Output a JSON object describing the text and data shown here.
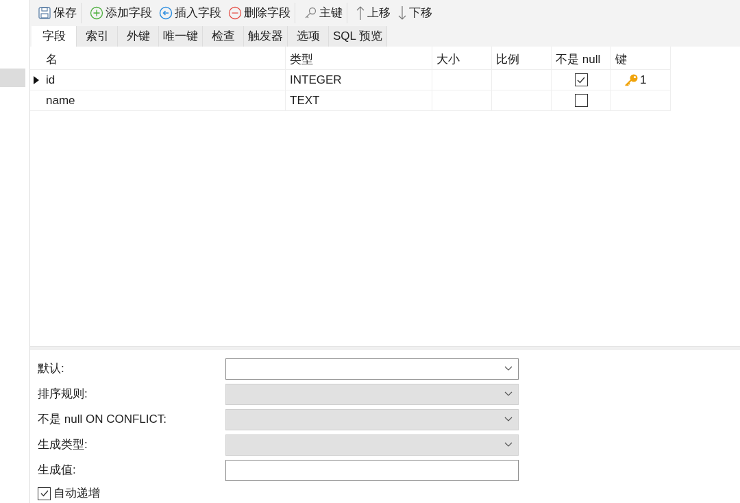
{
  "toolbar": [
    [
      {
        "kind": "save",
        "label": "保存"
      }
    ],
    [
      {
        "kind": "add",
        "label": "添加字段"
      },
      {
        "kind": "insert",
        "label": "插入字段"
      },
      {
        "kind": "delete",
        "label": "删除字段"
      }
    ],
    [
      {
        "kind": "key",
        "label": "主键"
      }
    ],
    [
      {
        "kind": "up",
        "label": "上移"
      },
      {
        "kind": "down",
        "label": "下移"
      }
    ]
  ],
  "tabs": [
    {
      "label": "字段",
      "selected": true
    },
    {
      "label": "索引",
      "selected": false
    },
    {
      "label": "外键",
      "selected": false
    },
    {
      "label": "唯一键",
      "selected": false
    },
    {
      "label": "检查",
      "selected": false
    },
    {
      "label": "触发器",
      "selected": false
    },
    {
      "label": "选项",
      "selected": false
    },
    {
      "label": "SQL 预览",
      "selected": false
    }
  ],
  "table": {
    "columns": [
      "名",
      "类型",
      "大小",
      "比例",
      "不是 null",
      "键"
    ],
    "rows": [
      {
        "current": true,
        "name": "id",
        "type": "INTEGER",
        "not_null": true,
        "primary_key": true,
        "key": "1"
      },
      {
        "current": false,
        "name": "name",
        "type": "TEXT",
        "not_null": false,
        "primary_key": false
      }
    ]
  },
  "properties": [
    {
      "label": "默认:",
      "kind": "select",
      "disabled": false
    },
    {
      "label": "排序规则:",
      "kind": "select",
      "disabled": true
    },
    {
      "label": "不是 null ON CONFLICT:",
      "kind": "select",
      "disabled": true
    },
    {
      "label": "生成类型:",
      "kind": "select",
      "disabled": true
    },
    {
      "label": "生成值:",
      "kind": "text",
      "disabled": false
    }
  ],
  "auto_increment": {
    "label": "自动递增",
    "checked": true
  }
}
